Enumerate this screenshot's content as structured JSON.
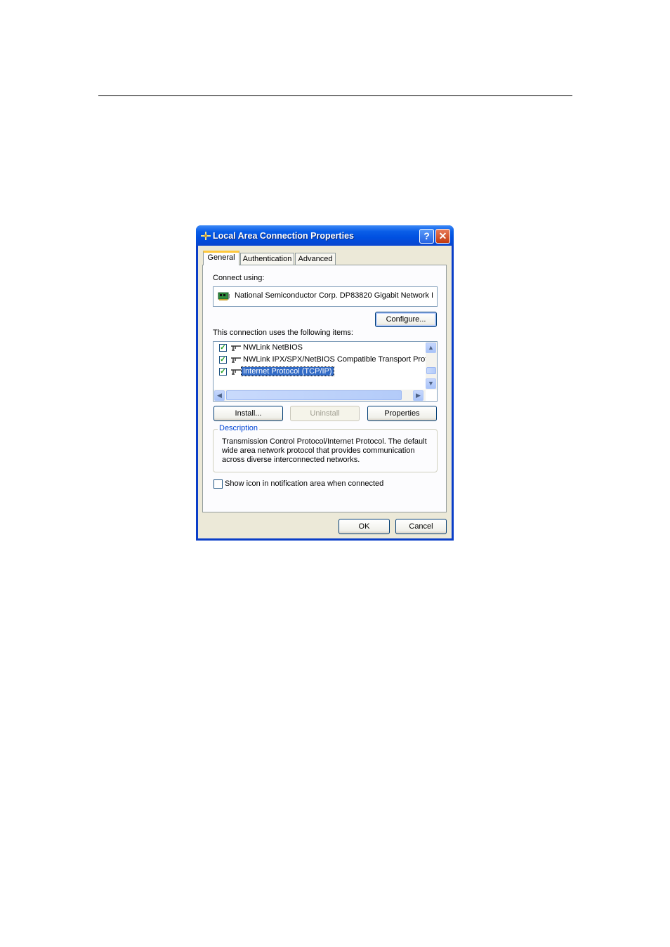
{
  "dialog": {
    "title": "Local Area Connection Properties",
    "help_glyph": "?",
    "close_glyph": "✕"
  },
  "tabs": [
    {
      "label": "General",
      "active": true
    },
    {
      "label": "Authentication",
      "active": false
    },
    {
      "label": "Advanced",
      "active": false
    }
  ],
  "general": {
    "connect_using_label": "Connect using:",
    "adapter_name": "National Semiconductor Corp. DP83820 Gigabit Network I",
    "configure_label": "Configure...",
    "items_label": "This connection uses the following items:",
    "items": [
      {
        "label": "NWLink NetBIOS",
        "checked": true,
        "selected": false
      },
      {
        "label": "NWLink IPX/SPX/NetBIOS Compatible Transport Prot",
        "checked": true,
        "selected": false
      },
      {
        "label": "Internet Protocol (TCP/IP)",
        "checked": true,
        "selected": true
      }
    ],
    "check_glyph": "✓",
    "install_label": "Install...",
    "uninstall_label": "Uninstall",
    "properties_label": "Properties",
    "description_title": "Description",
    "description_text": "Transmission Control Protocol/Internet Protocol. The default wide area network protocol that provides communication across diverse interconnected networks.",
    "show_icon_label": "Show icon in notification area when connected",
    "show_icon_checked": false
  },
  "footer": {
    "ok_label": "OK",
    "cancel_label": "Cancel"
  },
  "colors": {
    "title_bar": "#0050e0",
    "selection": "#316ac5",
    "active_tab_accent": "#ffc83c"
  }
}
